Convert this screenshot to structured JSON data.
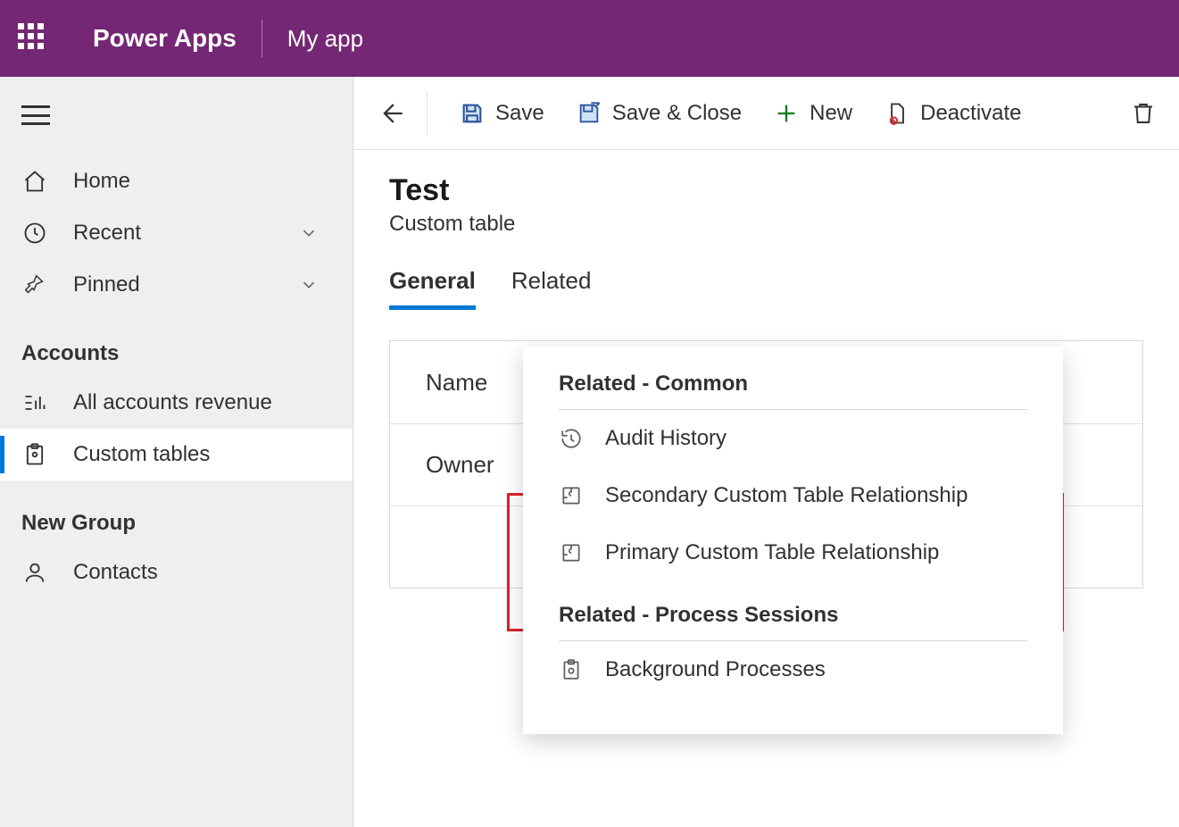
{
  "header": {
    "app_title": "Power Apps",
    "app_name": "My app"
  },
  "sidebar": {
    "home": "Home",
    "recent": "Recent",
    "pinned": "Pinned",
    "group1_label": "Accounts",
    "group1_items": [
      "All accounts revenue",
      "Custom tables"
    ],
    "group2_label": "New Group",
    "group2_items": [
      "Contacts"
    ]
  },
  "commands": {
    "save": "Save",
    "save_close": "Save & Close",
    "new": "New",
    "deactivate": "Deactivate"
  },
  "record": {
    "title": "Test",
    "subtitle": "Custom table"
  },
  "tabs": {
    "general": "General",
    "related": "Related"
  },
  "form": {
    "name_label": "Name",
    "owner_label": "Owner"
  },
  "flyout": {
    "section1_title": "Related - Common",
    "items1": [
      "Audit History",
      "Secondary Custom Table Relationship",
      "Primary Custom Table Relationship"
    ],
    "section2_title": "Related - Process Sessions",
    "items2": [
      "Background Processes"
    ]
  }
}
